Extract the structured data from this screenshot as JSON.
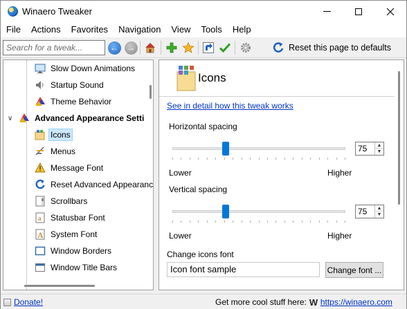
{
  "window": {
    "title": "Winaero Tweaker",
    "minimize_icon": "minimize-icon",
    "maximize_icon": "maximize-icon",
    "close_icon": "close-icon"
  },
  "menu": {
    "items": [
      "File",
      "Actions",
      "Favorites",
      "Navigation",
      "View",
      "Tools",
      "Help"
    ]
  },
  "toolbar": {
    "search_placeholder": "Search for a tweak...",
    "reset_label": "Reset this page to defaults"
  },
  "tree": {
    "items_above": [
      {
        "label": "Slow Down Animations",
        "icon": "monitor-icon"
      },
      {
        "label": "Startup Sound",
        "icon": "speaker-icon"
      },
      {
        "label": "Theme Behavior",
        "icon": "palette-icon"
      }
    ],
    "group": {
      "label": "Advanced Appearance Setti",
      "icon": "paint-bucket-icon"
    },
    "children": [
      {
        "label": "Icons",
        "icon": "icons-icon",
        "selected": true
      },
      {
        "label": "Menus",
        "icon": "menu-icon"
      },
      {
        "label": "Message Font",
        "icon": "message-font-icon"
      },
      {
        "label": "Reset Advanced Appearanc",
        "icon": "reset-icon"
      },
      {
        "label": "Scrollbars",
        "icon": "scrollbars-icon"
      },
      {
        "label": "Statusbar Font",
        "icon": "statusbar-font-icon"
      },
      {
        "label": "System Font",
        "icon": "system-font-icon"
      },
      {
        "label": "Window Borders",
        "icon": "window-borders-icon"
      },
      {
        "label": "Window Title Bars",
        "icon": "window-titlebar-icon"
      }
    ]
  },
  "content": {
    "title": "Icons",
    "detail_link": "See in detail how this tweak works",
    "horizontal": {
      "label": "Horizontal spacing",
      "value": "75",
      "position": 0.3,
      "lower": "Lower",
      "higher": "Higher"
    },
    "vertical": {
      "label": "Vertical spacing",
      "value": "75",
      "position": 0.3,
      "lower": "Lower",
      "higher": "Higher"
    },
    "font_label": "Change icons font",
    "font_sample": "Icon font sample",
    "change_font_button": "Change font ..."
  },
  "status": {
    "donate": "Donate!",
    "promo_text": "Get more cool stuff here:",
    "logo_letter": "W",
    "site_link": "https://winaero.com"
  },
  "colors": {
    "accent": "#0078d7",
    "link": "#0033cc",
    "selection": "#cce8ff"
  }
}
